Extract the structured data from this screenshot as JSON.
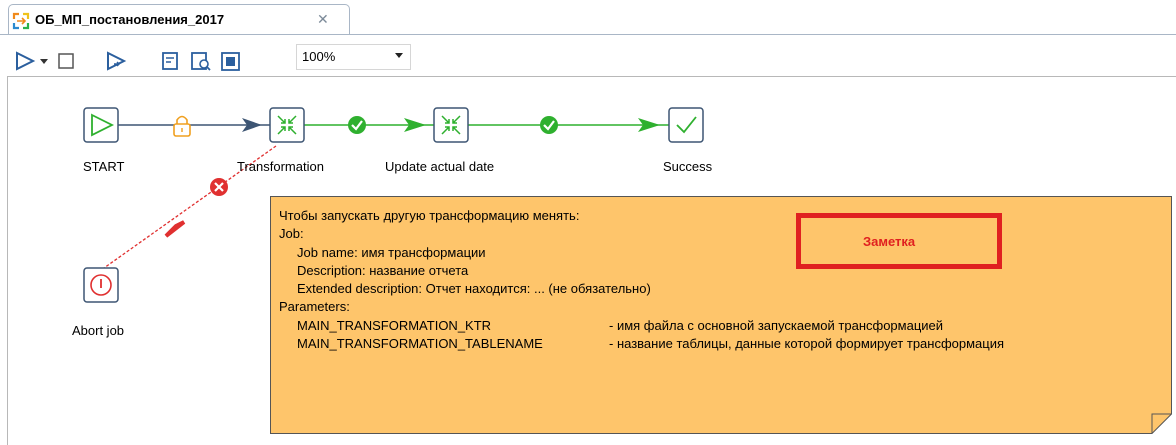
{
  "tab": {
    "title": "ОБ_МП_постановления_2017",
    "close_glyph": "✕"
  },
  "toolbar": {
    "zoom_value": "100%",
    "icons": [
      "run-icon",
      "run-dropdown-icon",
      "stop-icon",
      "preview-icon",
      "debug-icon",
      "check-icon",
      "layout-icon"
    ]
  },
  "flow": {
    "nodes": [
      {
        "id": "start",
        "label": "START",
        "icon": "play-icon"
      },
      {
        "id": "transformation",
        "label": "Transformation",
        "icon": "transformation-icon"
      },
      {
        "id": "update",
        "label": "Update actual date",
        "icon": "transformation-icon"
      },
      {
        "id": "success",
        "label": "Success",
        "icon": "checkmark-icon"
      },
      {
        "id": "abort",
        "label": "Abort job",
        "icon": "abort-icon"
      }
    ],
    "colors": {
      "hop_unconditional": "#3d5573",
      "hop_success": "#2fb02f",
      "hop_failure": "#e03030",
      "node_border": "#3d5573",
      "lock": "#f0a020"
    }
  },
  "note": {
    "lines": [
      "Чтобы запускать другую трансформацию менять:",
      "Job:",
      "Job name: имя трансформации",
      "Description: название отчета",
      "Extended description: Отчет находится: ... (не обязательно)",
      "Parameters:"
    ],
    "params": [
      {
        "name": "MAIN_TRANSFORMATION_KTR",
        "desc": "- имя файла с основной запускаемой трансформацией"
      },
      {
        "name": "MAIN_TRANSFORMATION_TABLENAME",
        "desc": "- название таблицы, данные которой формирует трансформация"
      }
    ],
    "stamp": "Заметка",
    "colors": {
      "background": "#fec56b",
      "stamp": "#e02020"
    }
  }
}
